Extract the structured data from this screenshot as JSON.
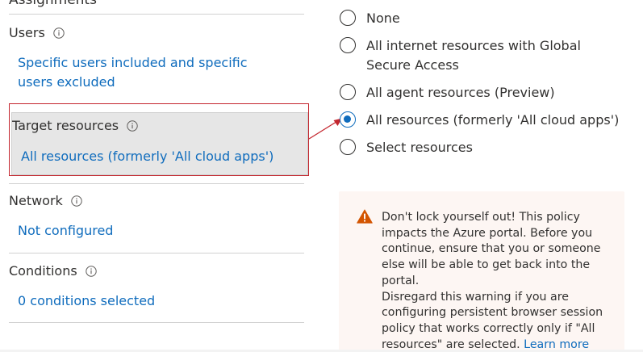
{
  "assignments": {
    "heading": "Assignments",
    "users": {
      "label": "Users",
      "value": "Specific users included and specific users excluded"
    },
    "target_resources": {
      "label": "Target resources",
      "value": "All resources (formerly 'All cloud apps')"
    },
    "network": {
      "label": "Network",
      "value": "Not configured"
    },
    "conditions": {
      "label": "Conditions",
      "value": "0 conditions selected"
    }
  },
  "resource_options": [
    {
      "label": "None",
      "checked": false
    },
    {
      "label": "All internet resources with Global Secure Access",
      "checked": false
    },
    {
      "label": "All agent resources (Preview)",
      "checked": false
    },
    {
      "label": "All resources (formerly 'All cloud apps')",
      "checked": true
    },
    {
      "label": "Select resources",
      "checked": false
    }
  ],
  "warning": {
    "line1": "Don't lock yourself out! This policy impacts the Azure portal. Before you continue, ensure that you or someone else will be able to get back into the portal.",
    "line2": "Disregard this warning if you are configuring persistent browser session policy that works correctly only if \"All resources\" are selected.",
    "link": "Learn more"
  },
  "colors": {
    "link_blue": "#0f6cbd",
    "highlight_red": "#c4262e",
    "warning_orange": "#d35400",
    "warning_bg": "#fdf6f3"
  },
  "icons": {
    "info": "info-icon",
    "warning": "warning-icon"
  }
}
